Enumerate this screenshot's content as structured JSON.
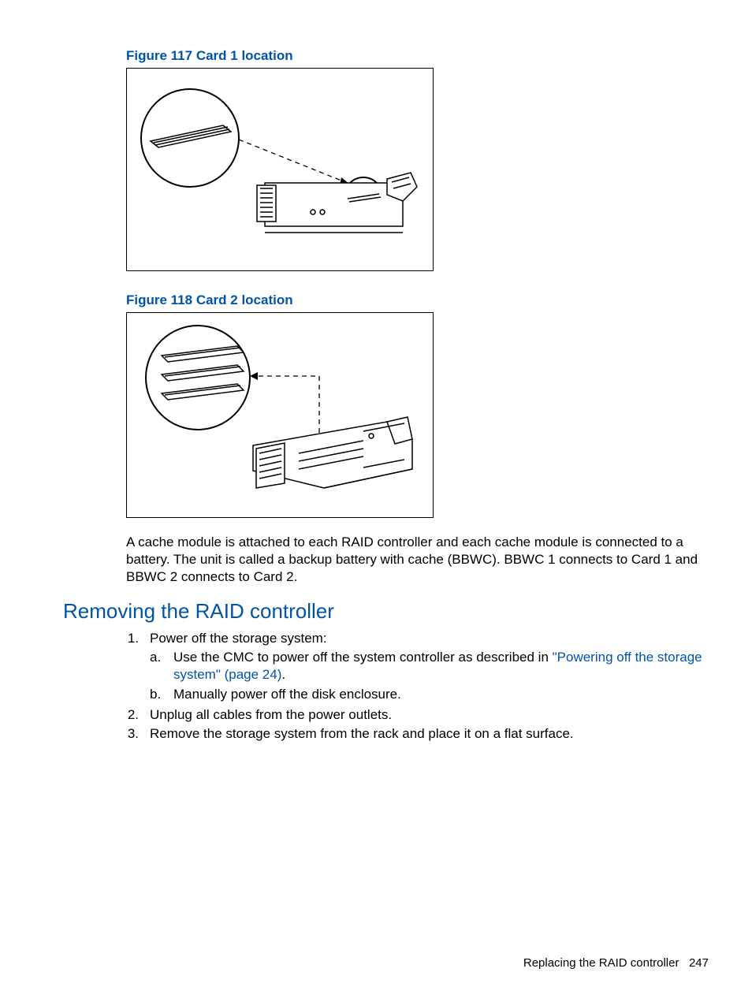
{
  "figures": {
    "fig1_caption": "Figure 117 Card 1 location",
    "fig2_caption": "Figure 118 Card 2 location"
  },
  "paragraph1": "A cache module is attached to each RAID controller and each cache module is connected to a battery. The unit is called a backup battery with cache (BBWC). BBWC 1 connects to Card 1 and BBWC 2 connects to Card 2.",
  "section_heading": "Removing the RAID controller",
  "list": {
    "item1": {
      "num": "1.",
      "text": "Power off the storage system:",
      "sub_a_letter": "a.",
      "sub_a_text_before": "Use the CMC to power off the system controller as described in ",
      "sub_a_link": "\"Powering off the storage system\" (page 24)",
      "sub_a_text_after": ".",
      "sub_b_letter": "b.",
      "sub_b_text": "Manually power off the disk enclosure."
    },
    "item2": {
      "num": "2.",
      "text": "Unplug all cables from the power outlets."
    },
    "item3": {
      "num": "3.",
      "text": "Remove the storage system from the rack and place it on a flat surface."
    }
  },
  "footer": {
    "section": "Replacing the RAID controller",
    "page": "247"
  }
}
